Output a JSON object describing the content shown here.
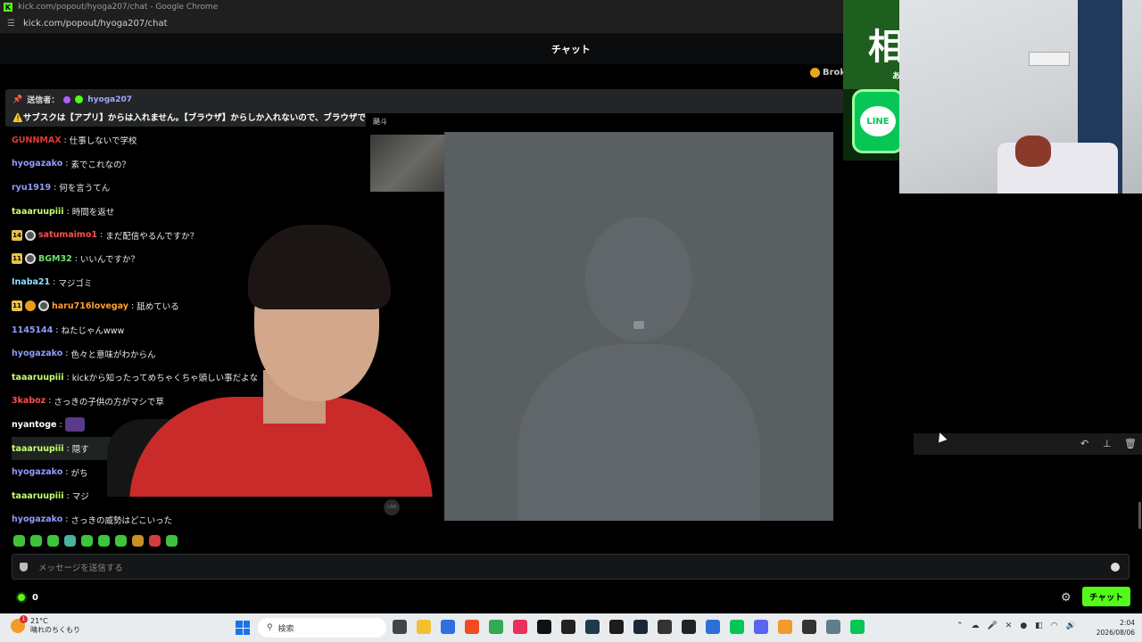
{
  "browser": {
    "title": "kick.com/popout/hyoga207/chat - Google Chrome",
    "url": "kick.com/popout/hyoga207/chat"
  },
  "chat_header": {
    "title": "チャット"
  },
  "broke_badge": {
    "label": "Brok"
  },
  "pinned": {
    "sender_label": "送信者：",
    "sender_name": "hyoga207",
    "message": "⚠️サブスクは【アプリ】からは入れません。【ブラウザ】からしか入れないので、ブラウザでオ..."
  },
  "messages": [
    {
      "user": "GUNNMAX",
      "color": "#e53935",
      "text": "仕事しないで学校"
    },
    {
      "user": "hyogazako",
      "color": "#8e9dff",
      "text": "素でこれなの？"
    },
    {
      "user": "ryu1919",
      "color": "#8e9dff",
      "text": "何を言うてん"
    },
    {
      "user": "taaaruupiii",
      "color": "#c6ff73",
      "text": "時間を返せ"
    },
    {
      "user": "satumaimo1",
      "color": "#ff4d4d",
      "text": "まだ配信やるんですか？",
      "badge": "14"
    },
    {
      "user": "BGM32",
      "color": "#6ee26e",
      "text": "いいんですか？",
      "badge": "11"
    },
    {
      "user": "Inaba21",
      "color": "#8ee0ff",
      "text": "マジゴミ"
    },
    {
      "user": "haru716lovegay",
      "color": "#ff9f2e",
      "text": "舐めている",
      "badge": "11"
    },
    {
      "user": "1145144",
      "color": "#8e9dff",
      "text": "ねたじゃんwww"
    },
    {
      "user": "hyogazako",
      "color": "#8e9dff",
      "text": "色々と意味がわからん"
    },
    {
      "user": "taaaruupiii",
      "color": "#c6ff73",
      "text": "kickから知ったってめちゃくちゃ頭しい事だよな"
    },
    {
      "user": "3kaboz",
      "color": "#ff4d4d",
      "text": "さっきの子供の方がマシで草"
    },
    {
      "user": "nyantoge",
      "color": "#ffffff",
      "text": ""
    },
    {
      "user": "taaaruupiii",
      "color": "#c6ff73",
      "text": "隠す"
    },
    {
      "user": "hyogazako",
      "color": "#8e9dff",
      "text": "がち"
    },
    {
      "user": "taaaruupiii",
      "color": "#c6ff73",
      "text": "マジ"
    },
    {
      "user": "hyogazako",
      "color": "#8e9dff",
      "text": "さっきの威勢はどこいった"
    }
  ],
  "input": {
    "placeholder": "メッセージを送信する"
  },
  "points": {
    "value": "0"
  },
  "chat_button": {
    "label": "チャット"
  },
  "call": {
    "name": "颶斗"
  },
  "promo": {
    "char": "相",
    "small": "あ",
    "line": "LINE"
  },
  "taskbar": {
    "temp": "21°C",
    "weather": "晴れのちくもり",
    "weather_badge": "1",
    "search": "検索",
    "time": "2:04",
    "date": "2026/08/06"
  }
}
